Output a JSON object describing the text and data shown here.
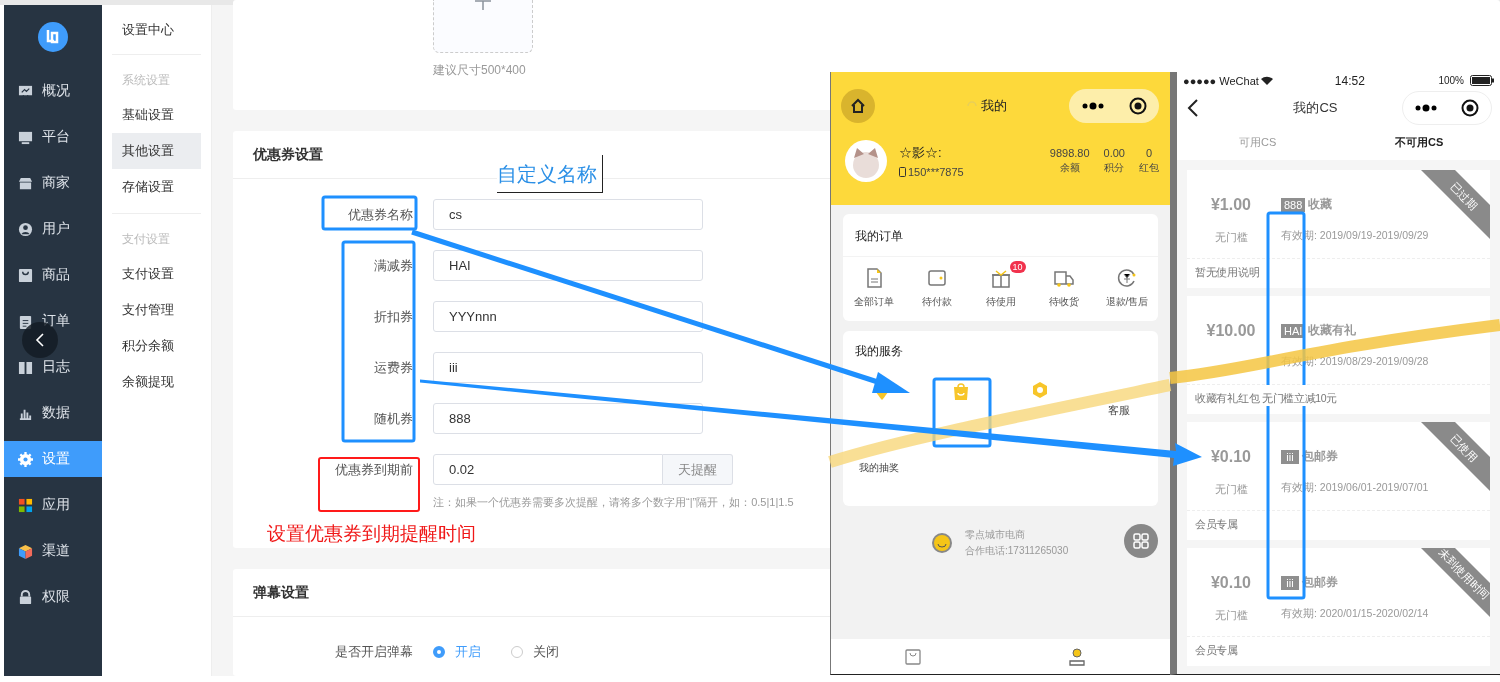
{
  "sidebar": {
    "items": [
      {
        "label": "概况",
        "selected": false
      },
      {
        "label": "平台",
        "selected": false
      },
      {
        "label": "商家",
        "selected": false
      },
      {
        "label": "用户",
        "selected": false
      },
      {
        "label": "商品",
        "selected": false
      },
      {
        "label": "订单",
        "selected": false
      },
      {
        "label": "日志",
        "selected": false
      },
      {
        "label": "数据",
        "selected": false
      },
      {
        "label": "设置",
        "selected": true
      },
      {
        "label": "应用",
        "selected": false
      },
      {
        "label": "渠道",
        "selected": false
      },
      {
        "label": "权限",
        "selected": false
      }
    ]
  },
  "subnav": {
    "title": "设置中心",
    "sections": [
      {
        "header": "系统设置",
        "items": [
          {
            "label": "基础设置",
            "selected": false
          },
          {
            "label": "其他设置",
            "selected": true
          },
          {
            "label": "存储设置",
            "selected": false
          }
        ]
      },
      {
        "header": "支付设置",
        "items": [
          {
            "label": "支付设置",
            "selected": false
          },
          {
            "label": "支付管理",
            "selected": false
          },
          {
            "label": "积分余额",
            "selected": false
          },
          {
            "label": "余额提现",
            "selected": false
          }
        ]
      }
    ]
  },
  "upload": {
    "hint": "建议尺寸500*400"
  },
  "coupon_settings": {
    "title": "优惠券设置",
    "fields": [
      {
        "label": "优惠券名称",
        "value": "cs"
      },
      {
        "label": "满减券",
        "value": "HAI"
      },
      {
        "label": "折扣券",
        "value": "YYYnnn"
      },
      {
        "label": "运费券",
        "value": "iii"
      },
      {
        "label": "随机券",
        "value": "888"
      }
    ],
    "expiry": {
      "label": "优惠券到期前",
      "value": "0.02",
      "suffix": "天提醒",
      "note": "注：如果一个优惠券需要多次提醒，请将多个数字用“|”隔开，如：0.5|1|1.5"
    }
  },
  "barrage_settings": {
    "title": "弹幕设置",
    "label": "是否开启弹幕",
    "options": [
      {
        "label": "开启",
        "selected": true
      },
      {
        "label": "关闭",
        "selected": false
      }
    ]
  },
  "annotations": {
    "custom_name": "自定义名称",
    "expiry_hint": "设置优惠券到期提醒时间"
  },
  "phone_profile": {
    "title": "我的",
    "user": {
      "name": "☆影☆:",
      "phone": "150***7875"
    },
    "stats": [
      {
        "value": "9898.80",
        "label": "余额"
      },
      {
        "value": "0.00",
        "label": "积分"
      },
      {
        "value": "0",
        "label": "红包"
      }
    ],
    "orders": {
      "title": "我的订单",
      "items": [
        {
          "label": "全部订单"
        },
        {
          "label": "待付款"
        },
        {
          "label": "待使用",
          "badge": "10"
        },
        {
          "label": "待收货"
        },
        {
          "label": "退款/售后"
        }
      ]
    },
    "services": {
      "title": "我的服务",
      "items": [
        {
          "label": "客服"
        },
        {
          "label": "我的抽奖"
        }
      ]
    },
    "footer": {
      "name": "零点城市电商",
      "phone": "合作电话:17311265030"
    }
  },
  "phone_coupons": {
    "status_bar": {
      "carrier": "●●●●● WeChat",
      "time": "14:52",
      "battery": "100%"
    },
    "title": "我的CS",
    "tabs": [
      {
        "label": "可用CS",
        "selected": false
      },
      {
        "label": "不可用CS",
        "selected": true
      }
    ],
    "coupons": [
      {
        "amount": "¥1.00",
        "threshold": "无门槛",
        "tag": "888",
        "name": "收藏",
        "validity": "有效期: 2019/09/19-2019/09/29",
        "note": "暂无使用说明",
        "status": "已过期"
      },
      {
        "amount": "¥10.00",
        "tag": "HAI",
        "name": "收藏有礼",
        "validity": "有效期: 2019/08/29-2019/09/28",
        "note": "收藏有礼红包 无门槛立减10元"
      },
      {
        "amount": "¥0.10",
        "threshold": "无门槛",
        "tag": "iii",
        "name": "包邮券",
        "validity": "有效期: 2019/06/01-2019/07/01",
        "note": "会员专属",
        "status": "已使用"
      },
      {
        "amount": "¥0.10",
        "threshold": "无门槛",
        "tag": "iii",
        "name": "包邮券",
        "validity": "有效期: 2020/01/15-2020/02/14",
        "note": "会员专属",
        "status": "未到使用时间"
      }
    ]
  }
}
